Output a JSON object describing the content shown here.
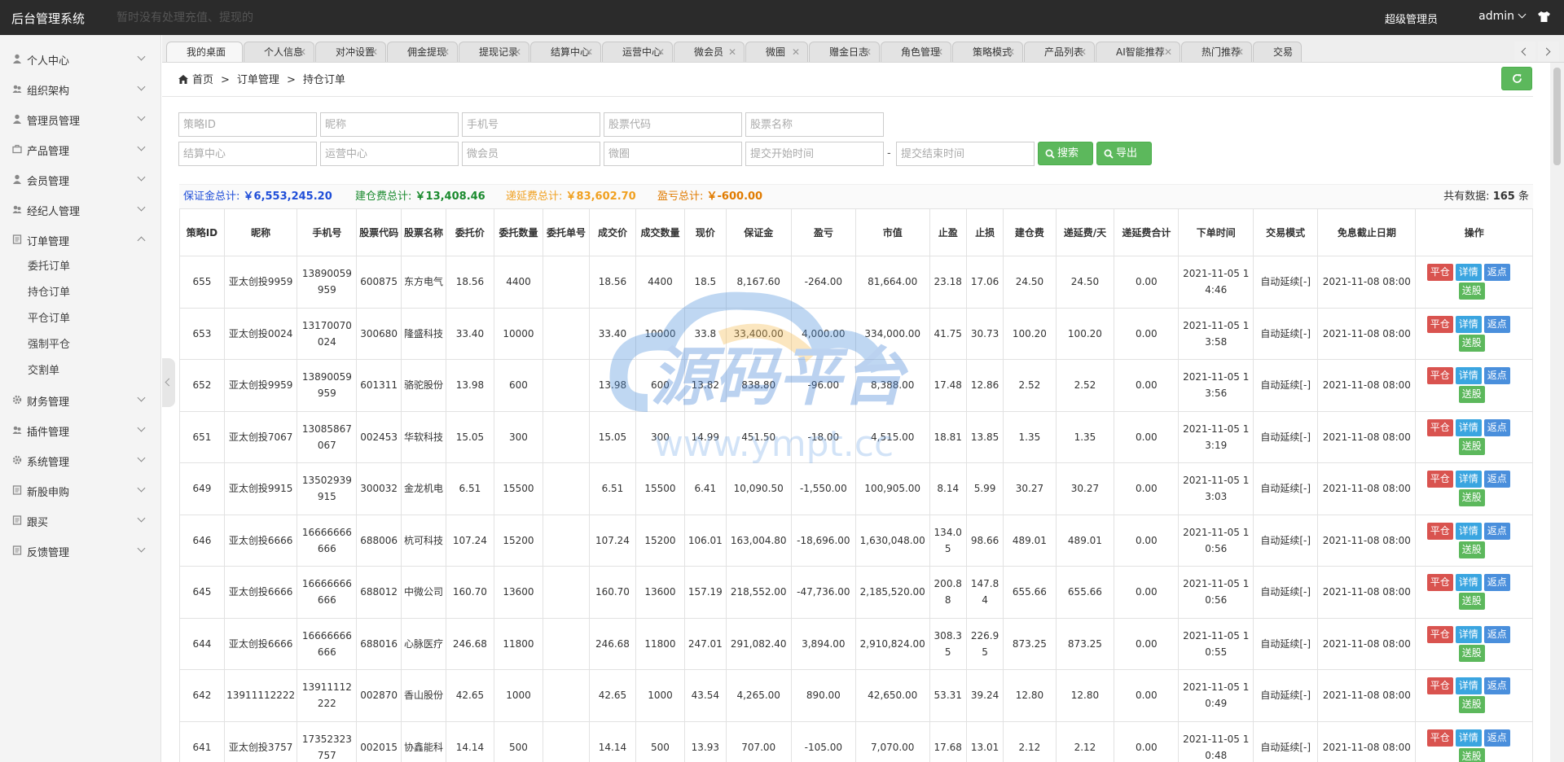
{
  "topbar": {
    "brand": "后台管理系统",
    "notice": "暂时没有处理充值、提现的",
    "role": "超级管理员",
    "user": "admin"
  },
  "sidebar": {
    "items": [
      {
        "label": "个人中心",
        "icon": "user-icon"
      },
      {
        "label": "组织架构",
        "icon": "org-icon"
      },
      {
        "label": "管理员管理",
        "icon": "user-icon"
      },
      {
        "label": "产品管理",
        "icon": "briefcase-icon"
      },
      {
        "label": "会员管理",
        "icon": "user-icon"
      },
      {
        "label": "经纪人管理",
        "icon": "agent-icon"
      },
      {
        "label": "订单管理",
        "icon": "doc-icon"
      }
    ],
    "sub_items": [
      "委托订单",
      "持仓订单",
      "平仓订单",
      "强制平仓",
      "交割单"
    ],
    "items_after": [
      {
        "label": "财务管理",
        "icon": "gear-icon"
      },
      {
        "label": "插件管理",
        "icon": "plugin-icon"
      },
      {
        "label": "系统管理",
        "icon": "gear-icon"
      },
      {
        "label": "新股申购",
        "icon": "doc-icon"
      },
      {
        "label": "跟买",
        "icon": "doc-icon"
      },
      {
        "label": "反馈管理",
        "icon": "doc-icon"
      }
    ]
  },
  "tabs": [
    "我的桌面",
    "个人信息",
    "对冲设置",
    "佣金提现",
    "提现记录",
    "结算中心",
    "运营中心",
    "微会员",
    "微圈",
    "赠金日志",
    "角色管理",
    "策略模式",
    "产品列表",
    "AI智能推荐",
    "热门推荐",
    "交易"
  ],
  "breadcrumb": {
    "home": "首页",
    "section": "订单管理",
    "page": "持仓订单"
  },
  "search": {
    "ph_strategy_id": "策略ID",
    "ph_nickname": "昵称",
    "ph_phone": "手机号",
    "ph_stock_code": "股票代码",
    "ph_stock_name": "股票名称",
    "ph_settle": "结算中心",
    "ph_ops_center": "运营中心",
    "ph_micro_member": "微会员",
    "ph_micro_circle": "微圈",
    "ph_start": "提交开始时间",
    "ph_end": "提交结束时间",
    "dash": "-",
    "search_label": "搜索",
    "export_label": "导出"
  },
  "summary": {
    "margin_label": "保证金总计:",
    "margin_value": "￥6,553,245.20",
    "build_label": "建仓费总计:",
    "build_value": "￥13,408.46",
    "defer_label": "递延费总计:",
    "defer_value": "￥83,602.70",
    "pnl_label": "盈亏总计:",
    "pnl_value": "￥-600.00",
    "total_prefix": "共有数据:",
    "total_count": "165",
    "total_suffix": "条",
    "colors": {
      "margin": "#1f4ed8",
      "build": "#1a8a2e",
      "defer": "#f0a020",
      "pnl": "#e07b00"
    }
  },
  "table": {
    "headers": [
      "策略ID",
      "昵称",
      "手机号",
      "股票代码",
      "股票名称",
      "委托价",
      "委托数量",
      "委托单号",
      "成交价",
      "成交数量",
      "现价",
      "保证金",
      "盈亏",
      "市值",
      "止盈",
      "止损",
      "建仓费",
      "递延费/天",
      "递延费合计",
      "下单时间",
      "交易模式",
      "免息截止日期",
      "操作"
    ],
    "rows": [
      [
        "655",
        "亚太创投9959",
        "13890059959",
        "600875",
        "东方电气",
        "18.56",
        "4400",
        "",
        "18.56",
        "4400",
        "18.5",
        "8,167.60",
        "-264.00",
        "81,664.00",
        "23.18",
        "17.06",
        "24.50",
        "24.50",
        "0.00",
        "2021-11-05 14:46",
        "自动延续[-]",
        "2021-11-08 08:00"
      ],
      [
        "653",
        "亚太创投0024",
        "13170070024",
        "300680",
        "隆盛科技",
        "33.40",
        "10000",
        "",
        "33.40",
        "10000",
        "33.8",
        "33,400.00",
        "4,000.00",
        "334,000.00",
        "41.75",
        "30.73",
        "100.20",
        "100.20",
        "0.00",
        "2021-11-05 13:58",
        "自动延续[-]",
        "2021-11-08 08:00"
      ],
      [
        "652",
        "亚太创投9959",
        "13890059959",
        "601311",
        "骆驼股份",
        "13.98",
        "600",
        "",
        "13.98",
        "600",
        "13.82",
        "838.80",
        "-96.00",
        "8,388.00",
        "17.48",
        "12.86",
        "2.52",
        "2.52",
        "0.00",
        "2021-11-05 13:56",
        "自动延续[-]",
        "2021-11-08 08:00"
      ],
      [
        "651",
        "亚太创投7067",
        "13085867067",
        "002453",
        "华软科技",
        "15.05",
        "300",
        "",
        "15.05",
        "300",
        "14.99",
        "451.50",
        "-18.00",
        "4,515.00",
        "18.81",
        "13.85",
        "1.35",
        "1.35",
        "0.00",
        "2021-11-05 13:19",
        "自动延续[-]",
        "2021-11-08 08:00"
      ],
      [
        "649",
        "亚太创投9915",
        "13502939915",
        "300032",
        "金龙机电",
        "6.51",
        "15500",
        "",
        "6.51",
        "15500",
        "6.41",
        "10,090.50",
        "-1,550.00",
        "100,905.00",
        "8.14",
        "5.99",
        "30.27",
        "30.27",
        "0.00",
        "2021-11-05 13:03",
        "自动延续[-]",
        "2021-11-08 08:00"
      ],
      [
        "646",
        "亚太创投6666",
        "16666666666",
        "688006",
        "杭可科技",
        "107.24",
        "15200",
        "",
        "107.24",
        "15200",
        "106.01",
        "163,004.80",
        "-18,696.00",
        "1,630,048.00",
        "134.05",
        "98.66",
        "489.01",
        "489.01",
        "0.00",
        "2021-11-05 10:56",
        "自动延续[-]",
        "2021-11-08 08:00"
      ],
      [
        "645",
        "亚太创投6666",
        "16666666666",
        "688012",
        "中微公司",
        "160.70",
        "13600",
        "",
        "160.70",
        "13600",
        "157.19",
        "218,552.00",
        "-47,736.00",
        "2,185,520.00",
        "200.88",
        "147.84",
        "655.66",
        "655.66",
        "0.00",
        "2021-11-05 10:56",
        "自动延续[-]",
        "2021-11-08 08:00"
      ],
      [
        "644",
        "亚太创投6666",
        "16666666666",
        "688016",
        "心脉医疗",
        "246.68",
        "11800",
        "",
        "246.68",
        "11800",
        "247.01",
        "291,082.40",
        "3,894.00",
        "2,910,824.00",
        "308.35",
        "226.95",
        "873.25",
        "873.25",
        "0.00",
        "2021-11-05 10:55",
        "自动延续[-]",
        "2021-11-08 08:00"
      ],
      [
        "642",
        "13911112222",
        "13911112222",
        "002870",
        "香山股份",
        "42.65",
        "1000",
        "",
        "42.65",
        "1000",
        "43.54",
        "4,265.00",
        "890.00",
        "42,650.00",
        "53.31",
        "39.24",
        "12.80",
        "12.80",
        "0.00",
        "2021-11-05 10:49",
        "自动延续[-]",
        "2021-11-08 08:00"
      ],
      [
        "641",
        "亚太创投3757",
        "17352323757",
        "002015",
        "协鑫能科",
        "14.14",
        "500",
        "",
        "14.14",
        "500",
        "13.93",
        "707.00",
        "-105.00",
        "7,070.00",
        "17.68",
        "13.01",
        "2.12",
        "2.12",
        "0.00",
        "2021-11-05 10:48",
        "自动延续[-]",
        "2021-11-08 08:00"
      ]
    ],
    "actions": {
      "close": "平仓",
      "detail": "详情",
      "rebate": "返点",
      "gift": "送股"
    }
  },
  "watermark": {
    "cn": "源码平台",
    "url": "www.ympt.cc"
  }
}
